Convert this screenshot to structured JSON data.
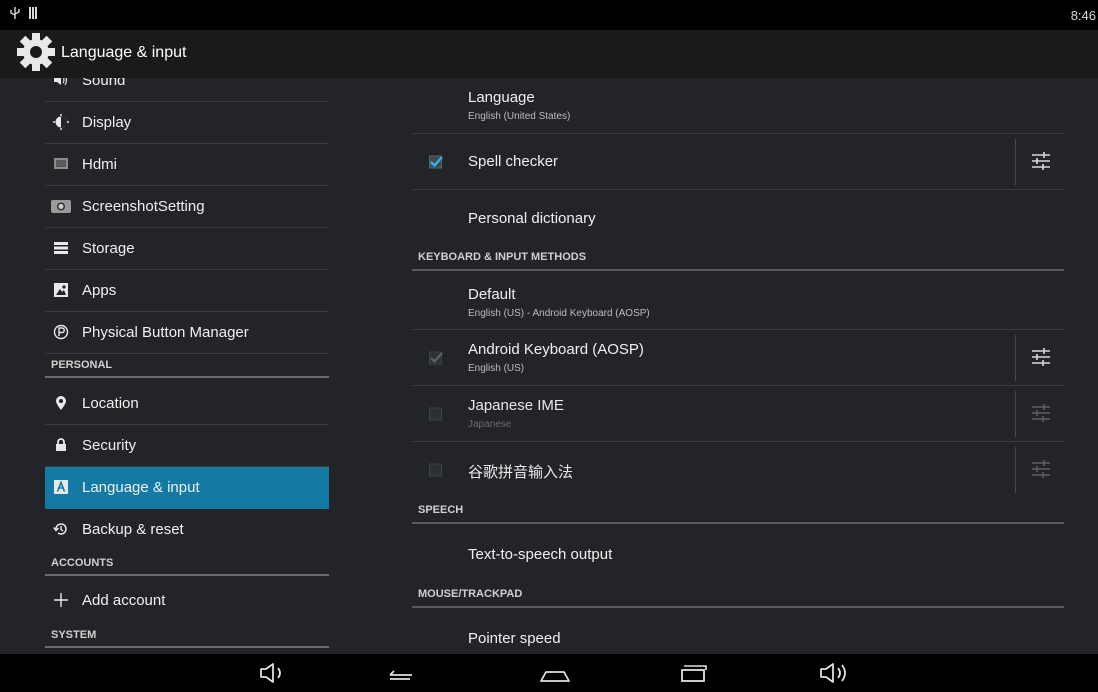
{
  "status_bar": {
    "time": "8:46",
    "usb_icon": "usb-icon",
    "signal_icon": "sdcard-icon"
  },
  "action_bar": {
    "title": "Language & input",
    "icon": "settings-gear-icon"
  },
  "sidebar": {
    "items": [
      {
        "label": "Sound",
        "icon": "sound-icon"
      },
      {
        "label": "Display",
        "icon": "display-icon"
      },
      {
        "label": "Hdmi",
        "icon": "hdmi-icon"
      },
      {
        "label": "ScreenshotSetting",
        "icon": "camera-icon"
      },
      {
        "label": "Storage",
        "icon": "storage-icon"
      },
      {
        "label": "Apps",
        "icon": "apps-icon"
      },
      {
        "label": "Physical Button Manager",
        "icon": "p-circle-icon"
      }
    ],
    "personal_header": "PERSONAL",
    "personal": [
      {
        "label": "Location",
        "icon": "location-pin-icon"
      },
      {
        "label": "Security",
        "icon": "lock-icon"
      },
      {
        "label": "Language & input",
        "icon": "language-a-icon",
        "selected": true
      },
      {
        "label": "Backup & reset",
        "icon": "backup-icon"
      }
    ],
    "accounts_header": "ACCOUNTS",
    "accounts": [
      {
        "label": "Add account",
        "icon": "plus-icon"
      }
    ],
    "system_header": "SYSTEM"
  },
  "main": {
    "language": {
      "title": "Language",
      "summary": "English (United States)"
    },
    "spell_checker": {
      "title": "Spell checker",
      "checked": true,
      "settings_icon": "tune-icon"
    },
    "personal_dictionary": {
      "title": "Personal dictionary"
    },
    "keyboard_header": "KEYBOARD & INPUT METHODS",
    "default": {
      "title": "Default",
      "summary": "English (US) - Android Keyboard (AOSP)"
    },
    "android_keyboard": {
      "title": "Android Keyboard (AOSP)",
      "summary": "English (US)",
      "checked": true,
      "enabled": false
    },
    "japanese_ime": {
      "title": "Japanese IME",
      "summary": "Japanese",
      "checked": false
    },
    "google_pinyin": {
      "title": "谷歌拼音输入法",
      "checked": false
    },
    "speech_header": "SPEECH",
    "tts": {
      "title": "Text-to-speech output"
    },
    "mouse_header": "MOUSE/TRACKPAD",
    "pointer_speed": {
      "title": "Pointer speed"
    }
  },
  "nav_bar": {
    "buttons": [
      "volume-down-icon",
      "back-icon",
      "home-icon",
      "recents-icon",
      "volume-up-icon"
    ]
  },
  "colors": {
    "accent": "#147aa4",
    "check": "#33b5e5",
    "background": "#222427"
  }
}
